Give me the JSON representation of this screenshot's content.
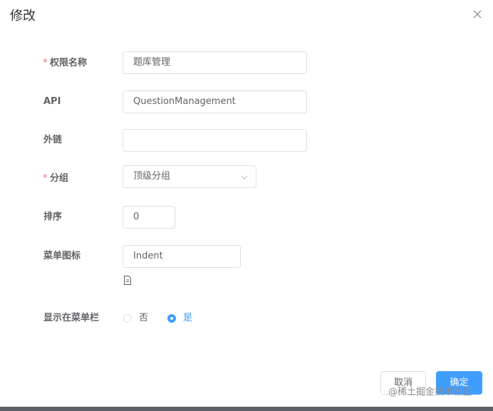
{
  "dialog": {
    "title": "修改"
  },
  "form": {
    "required_mark": "*",
    "name": {
      "label": "权限名称",
      "value": "题库管理"
    },
    "api": {
      "label": "API",
      "value": "QuestionManagement"
    },
    "external_link": {
      "label": "外链",
      "value": ""
    },
    "group": {
      "label": "分组",
      "value": "顶级分组"
    },
    "order": {
      "label": "排序",
      "value": "0"
    },
    "menu_icon": {
      "label": "菜单图标",
      "value": "Indent",
      "preview_icon": "document-icon"
    },
    "show_in_menu": {
      "label": "显示在菜单栏",
      "options": [
        {
          "label": "否",
          "checked": false
        },
        {
          "label": "是",
          "checked": true
        }
      ]
    }
  },
  "footer": {
    "cancel_label": "取消",
    "confirm_label": "确定"
  },
  "watermark": "@稀土掘金技术社区",
  "colors": {
    "primary": "#409eff",
    "required": "#f56c6c",
    "border": "#dcdfe6",
    "text": "#606266"
  }
}
